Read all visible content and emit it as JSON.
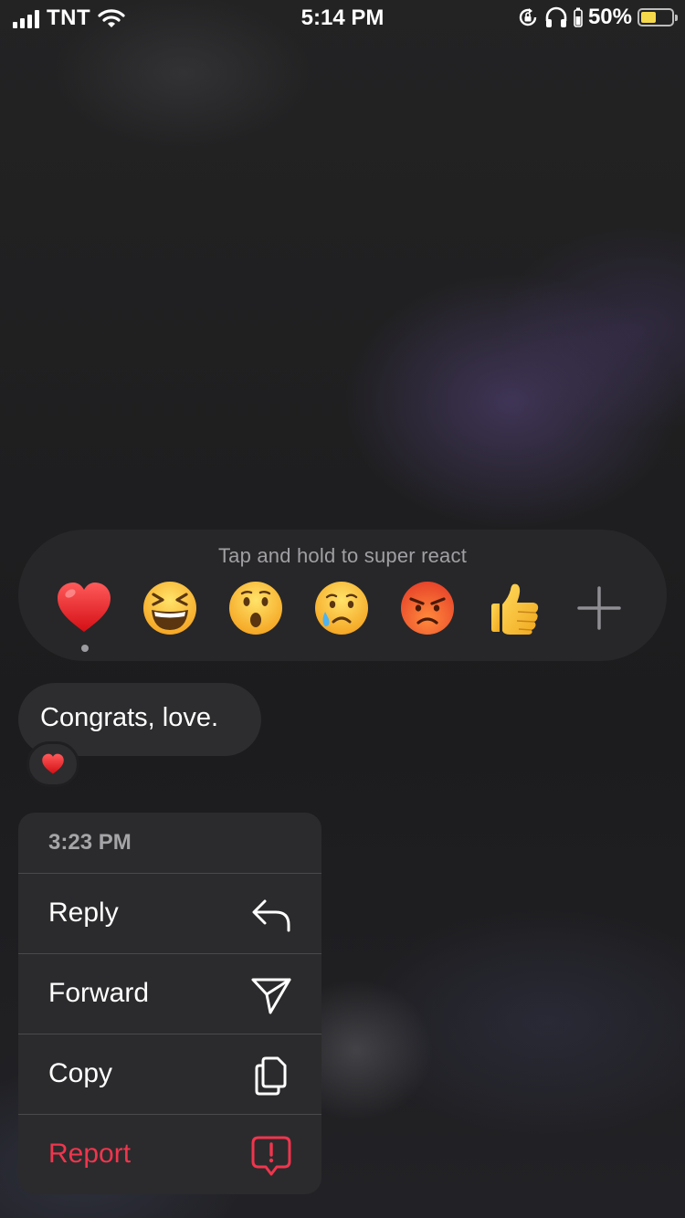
{
  "status_bar": {
    "carrier": "TNT",
    "time": "5:14 PM",
    "battery_percent": "50%",
    "battery_level": 0.5,
    "icons": [
      "signal-icon",
      "wifi-icon",
      "orientation-lock-icon",
      "headphones-icon",
      "battery-icon"
    ]
  },
  "reactions": {
    "hint": "Tap and hold to super react",
    "emojis": [
      "heart",
      "laughing-squint",
      "surprised",
      "crying",
      "angry",
      "thumbs-up"
    ],
    "selected": "heart",
    "more_icon": "plus-icon"
  },
  "message": {
    "text": "Congrats, love.",
    "reaction": "heart"
  },
  "context_menu": {
    "timestamp": "3:23 PM",
    "items": [
      {
        "label": "Reply",
        "icon": "reply-icon"
      },
      {
        "label": "Forward",
        "icon": "send-icon"
      },
      {
        "label": "Copy",
        "icon": "copy-icon"
      },
      {
        "label": "Report",
        "icon": "report-icon",
        "color": "#f0354d"
      }
    ]
  },
  "colors": {
    "danger": "#f0354d",
    "battery": "#f6d94a"
  }
}
